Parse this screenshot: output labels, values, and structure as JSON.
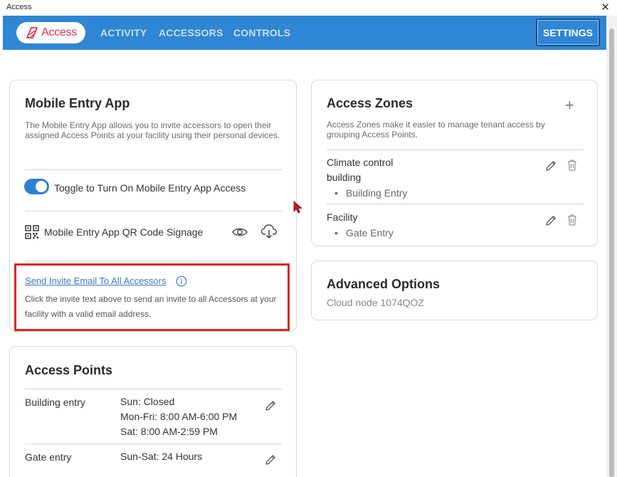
{
  "window": {
    "title": "Access",
    "close_glyph": "✕"
  },
  "nav": {
    "logo_text": "Access",
    "links": [
      "ACTIVITY",
      "ACCESSORS",
      "CONTROLS"
    ],
    "settings_label": "SETTINGS",
    "brand_color": "#2f86d4",
    "logo_color": "#e0304b"
  },
  "mobile_entry": {
    "title": "Mobile Entry App",
    "description": "The Mobile Entry App allows you to invite accessors to open their assigned Access Points at your facility using their personal devices.",
    "toggle_label": "Toggle to Turn On Mobile Entry App Access",
    "toggle_on": true,
    "qr_label": "Mobile Entry App QR Code Signage",
    "invite_link": "Send Invite Email To All Accessors",
    "invite_description": "Click the invite text above to send an invite to all Accessors at your facility with a valid email address.",
    "highlight_color": "#e0251b"
  },
  "access_zones": {
    "title": "Access Zones",
    "add_glyph": "+",
    "description": "Access Zones make it easier to manage tenant access by grouping Access Points.",
    "zones": [
      {
        "name": "Climate control building",
        "name_line1": "Climate control",
        "name_line2": "building",
        "points": [
          "Building Entry"
        ]
      },
      {
        "name": "Facility",
        "points": [
          "Gate Entry"
        ]
      }
    ]
  },
  "advanced_options": {
    "title": "Advanced Options",
    "cloud_node": "Cloud node 1074QOZ"
  },
  "access_points": {
    "title": "Access Points",
    "rows": [
      {
        "name": "Building entry",
        "hours": [
          "Sun: Closed",
          "Mon-Fri: 8:00 AM-6:00 PM",
          "Sat: 8:00 AM-2:59 PM"
        ]
      },
      {
        "name": "Gate entry",
        "hours": [
          "Sun-Sat: 24 Hours"
        ]
      }
    ]
  },
  "icons": [
    "access-logo-icon",
    "close-icon",
    "qr-code-icon",
    "eye-icon",
    "cloud-download-icon",
    "info-icon",
    "plus-icon",
    "pencil-icon",
    "trash-icon",
    "mouse-cursor-icon"
  ]
}
